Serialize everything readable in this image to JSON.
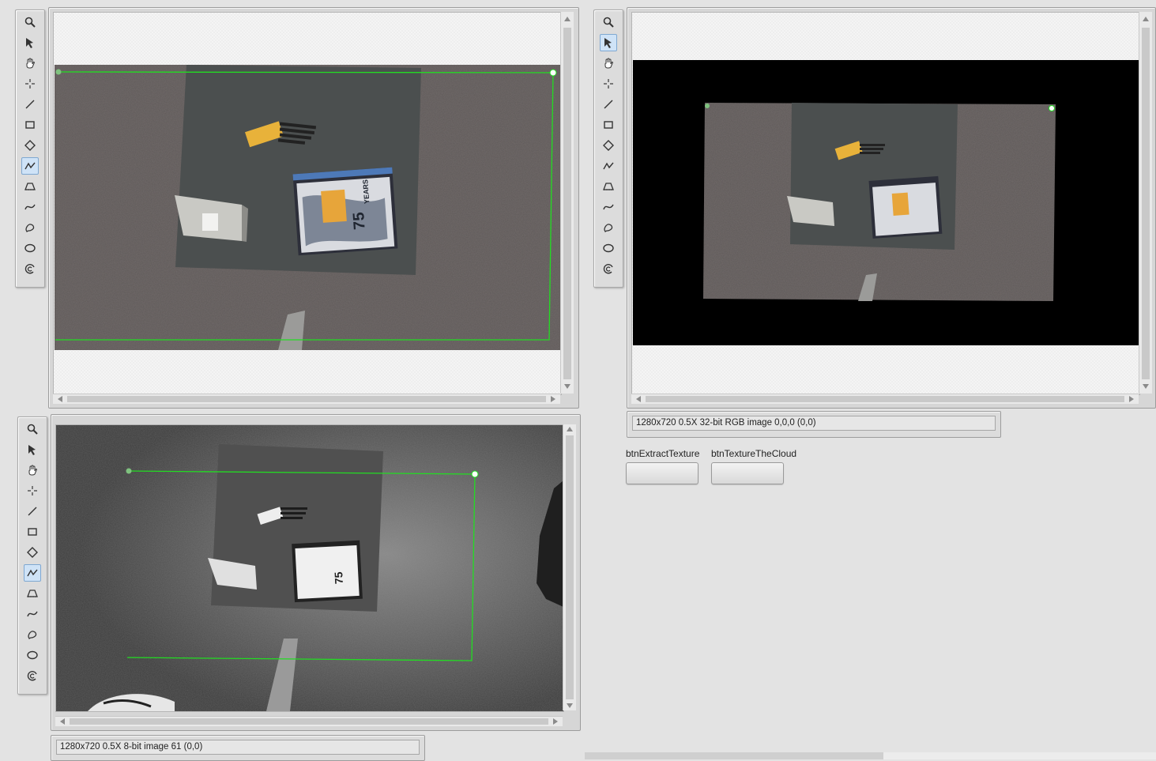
{
  "tools": [
    "zoom-icon",
    "pointer-icon",
    "pan-hand-icon",
    "crosshair-icon",
    "line-icon",
    "rectangle-icon",
    "rotated-rect-icon",
    "polyline-icon",
    "polygon-icon",
    "freeline-icon",
    "freeregion-icon",
    "oval-icon",
    "annulus-icon"
  ],
  "displays": {
    "top_left": {
      "active_tool": 7
    },
    "top_right": {
      "active_tool": 1
    },
    "bottom_left": {
      "active_tool": 7
    }
  },
  "info": {
    "rgb_image": "1280x720 0.5X 32-bit RGB image 0,0,0    (0,0)",
    "gray_image": "1280x720 0.5X 8-bit image 61    (0,0)"
  },
  "buttons": {
    "extract_texture": {
      "label": "btnExtractTexture"
    },
    "texture_cloud": {
      "label": "btnTextureTheCloud"
    }
  },
  "colors": {
    "roi": "#22dd22",
    "carpet": "#5f5a59",
    "mat": "#4b4f4f",
    "black_bg": "#000000"
  },
  "book": {
    "num": "75",
    "word": "YEARS"
  }
}
